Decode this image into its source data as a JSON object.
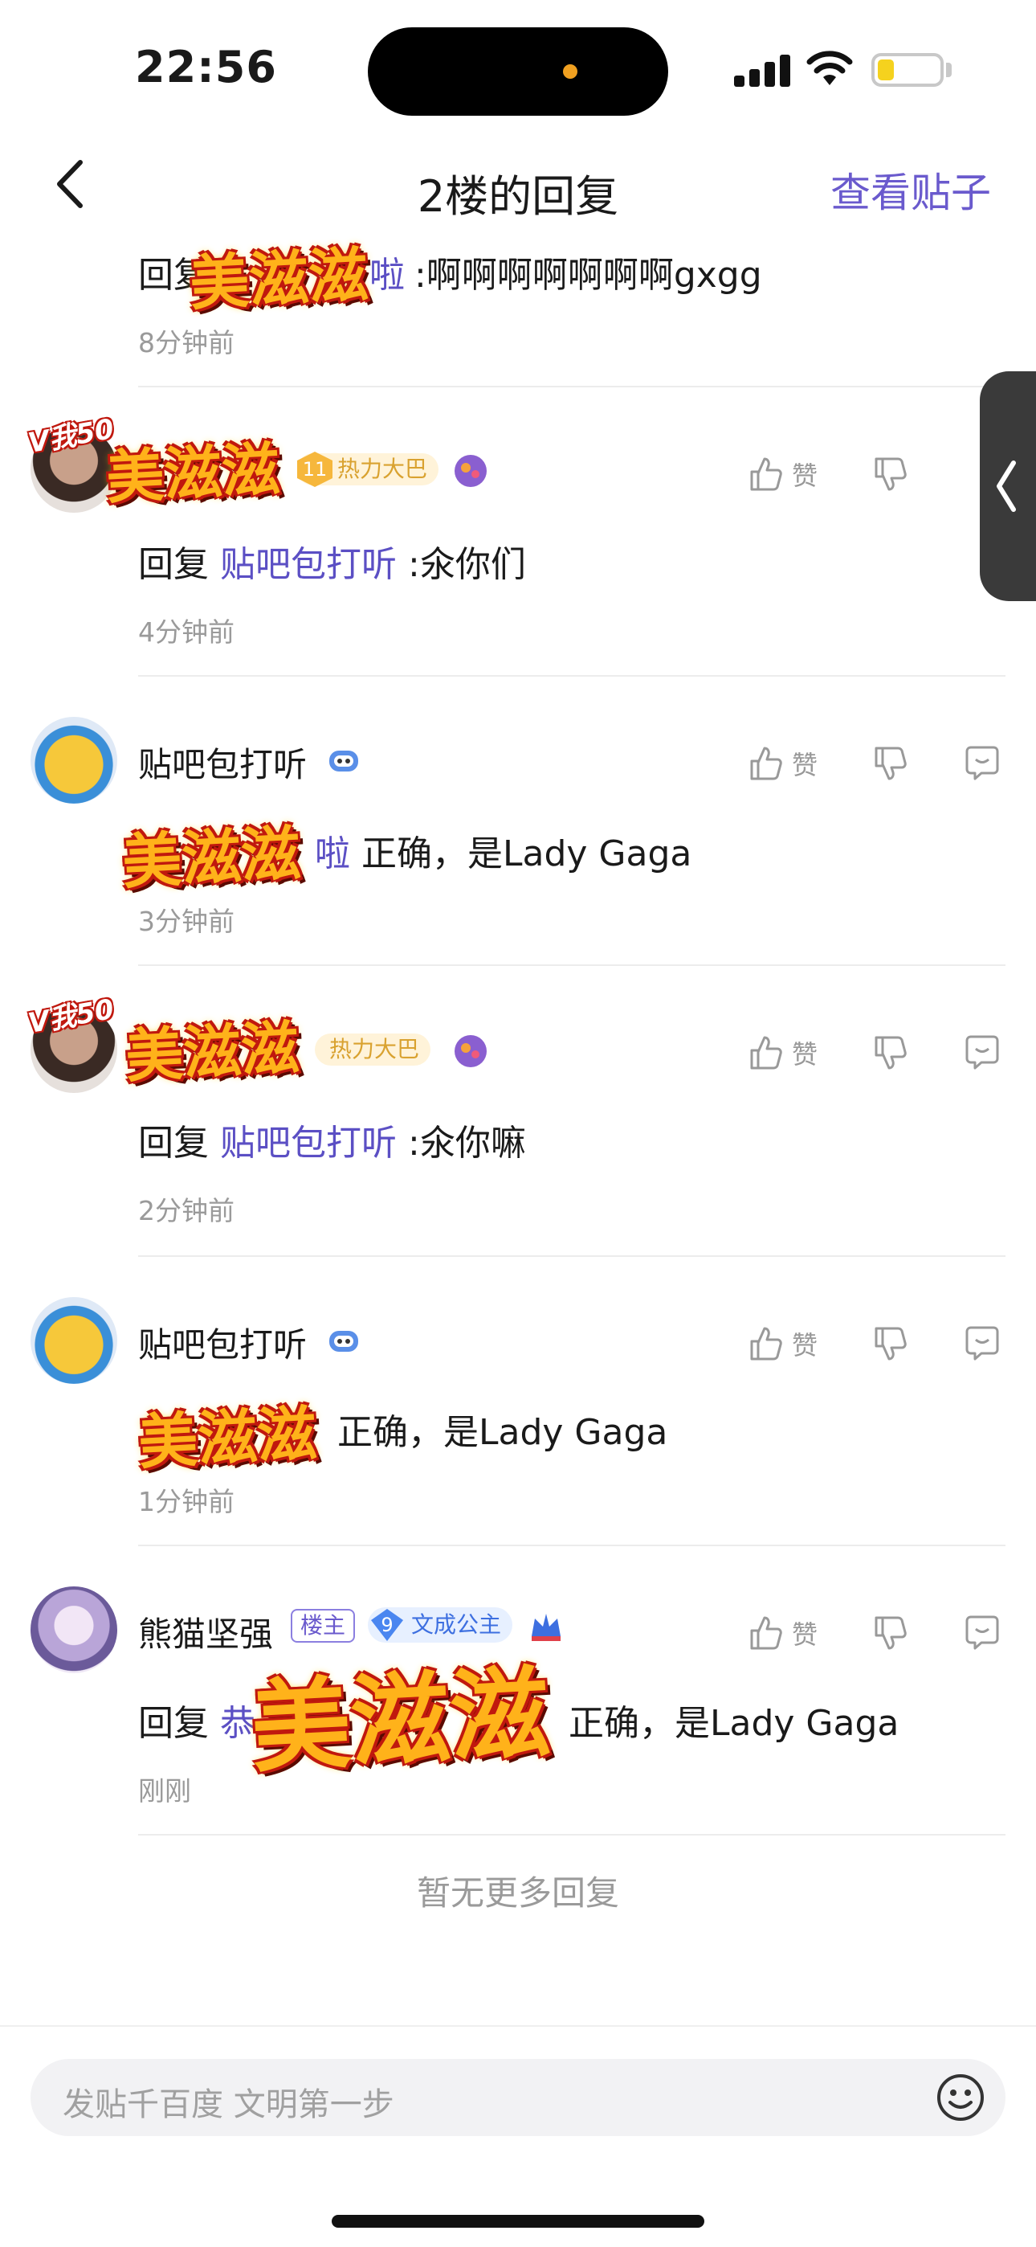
{
  "status": {
    "time": "22:56"
  },
  "nav": {
    "back_icon": "chevron-left-icon",
    "title": "2楼的回复",
    "action": "查看贴子"
  },
  "sticker_text": "美滋滋",
  "v50_text": "V我50",
  "replies": [
    {
      "content_prefix": "回复",
      "content_link": "啦",
      "content_text": ":啊啊啊啊啊啊啊gxgg",
      "time": "8分钟前"
    },
    {
      "badge_level": "11",
      "badge_text": "热力大巴",
      "content_prefix": "回复",
      "content_link": "贴吧包打听",
      "content_text": ":氽你们",
      "time": "4分钟前",
      "like": "赞"
    },
    {
      "name": "贴吧包打听",
      "content_link": "啦",
      "content_text": "正确，是Lady Gaga",
      "time": "3分钟前",
      "like": "赞"
    },
    {
      "badge_text": "热力大巴",
      "content_prefix": "回复",
      "content_link": "贴吧包打听",
      "content_text": ":氽你嘛",
      "time": "2分钟前",
      "like": "赞"
    },
    {
      "name": "贴吧包打听",
      "content_text": "正确，是Lady Gaga",
      "time": "1分钟前",
      "like": "赞"
    },
    {
      "name": "熊猫坚强",
      "owner_badge": "楼主",
      "title_level": "9",
      "title_text": "文成公主",
      "content_prefix": "回复",
      "content_link": "恭",
      "content_text": "正确，是Lady Gaga",
      "time": "刚刚",
      "like": "赞"
    }
  ],
  "no_more": "暂无更多回复",
  "input": {
    "placeholder": "发贴千百度 文明第一步"
  },
  "colors": {
    "accent": "#6a5acd",
    "link": "#5b4fc4",
    "muted": "#9a9a9a"
  }
}
